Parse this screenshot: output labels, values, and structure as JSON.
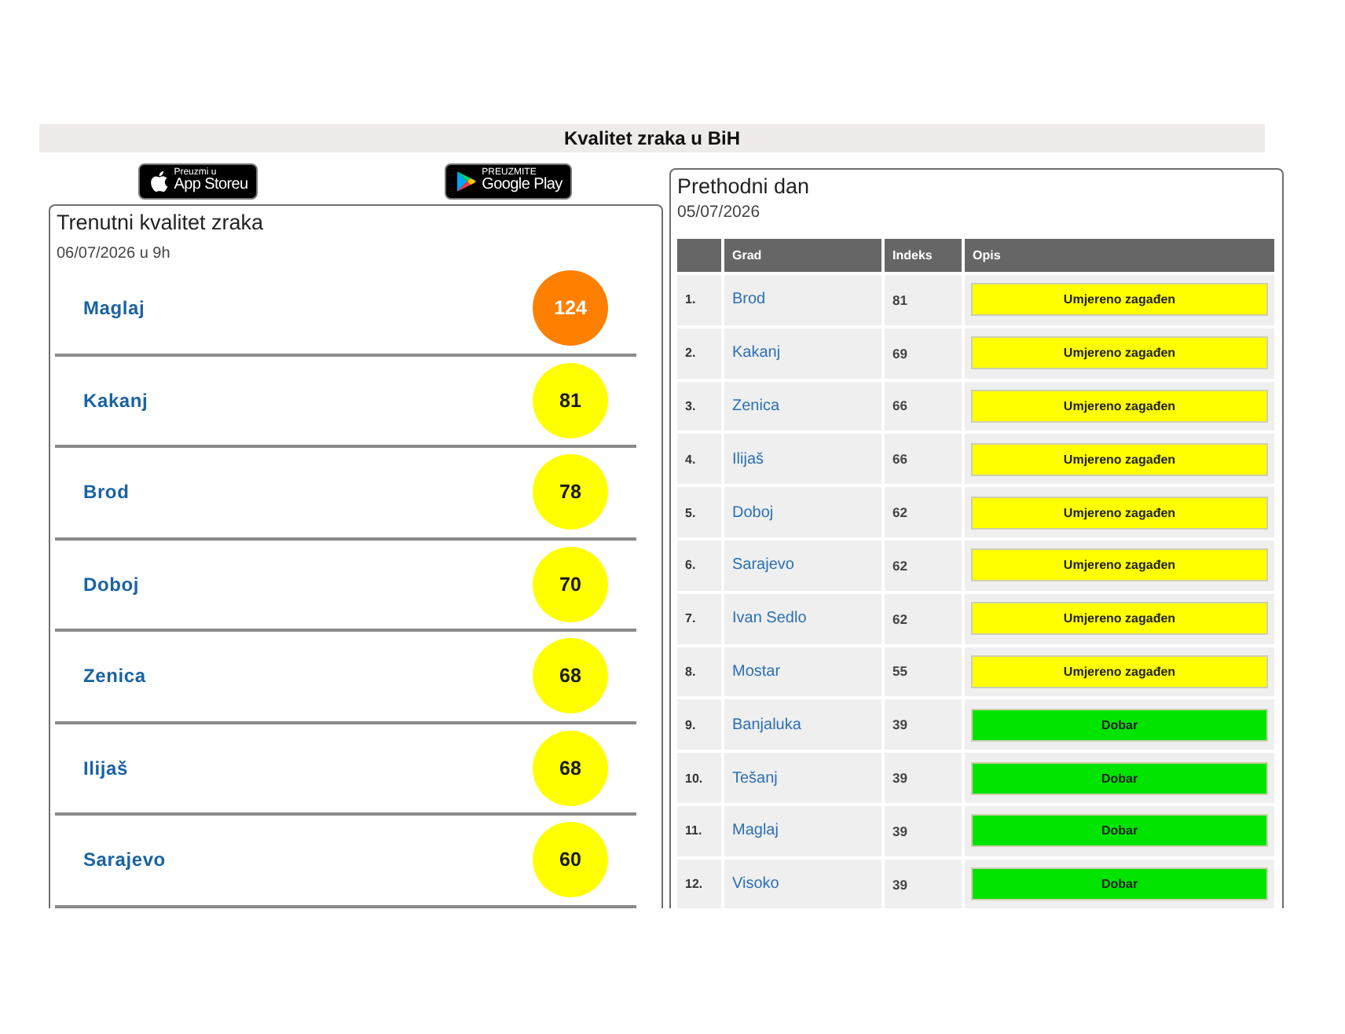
{
  "header": {
    "title": "Kvalitet zraka u BiH"
  },
  "store_badges": [
    {
      "kind": "apple",
      "caption": "Preuzmi u",
      "label": "App Storeu"
    },
    {
      "kind": "google",
      "caption": "PREUZMITE",
      "label": "Google Play"
    }
  ],
  "current": {
    "title": "Trenutni kvalitet zraka",
    "date": "06/07/2026 u 9h",
    "cities": [
      {
        "name": "Maglaj",
        "index": "124",
        "color": "#ff7f00"
      },
      {
        "name": "Kakanj",
        "index": "81",
        "color": "#ffff00"
      },
      {
        "name": "Brod",
        "index": "78",
        "color": "#ffff00"
      },
      {
        "name": "Doboj",
        "index": "70",
        "color": "#ffff00"
      },
      {
        "name": "Zenica",
        "index": "68",
        "color": "#ffff00"
      },
      {
        "name": "Ilijaš",
        "index": "68",
        "color": "#ffff00"
      },
      {
        "name": "Sarajevo",
        "index": "60",
        "color": "#ffff00"
      }
    ]
  },
  "previous": {
    "title": "Prethodni dan",
    "date": "05/07/2026",
    "columns": [
      "Grad",
      "Indeks",
      "Opis"
    ],
    "rows": [
      {
        "rank": "1.",
        "city": "Brod",
        "index": "81",
        "description": "Umjereno zagađen",
        "color": "#ffff00"
      },
      {
        "rank": "2.",
        "city": "Kakanj",
        "index": "69",
        "description": "Umjereno zagađen",
        "color": "#ffff00"
      },
      {
        "rank": "3.",
        "city": "Zenica",
        "index": "66",
        "description": "Umjereno zagađen",
        "color": "#ffff00"
      },
      {
        "rank": "4.",
        "city": "Ilijaš",
        "index": "66",
        "description": "Umjereno zagađen",
        "color": "#ffff00"
      },
      {
        "rank": "5.",
        "city": "Doboj",
        "index": "62",
        "description": "Umjereno zagađen",
        "color": "#ffff00"
      },
      {
        "rank": "6.",
        "city": "Sarajevo",
        "index": "62",
        "description": "Umjereno zagađen",
        "color": "#ffff00"
      },
      {
        "rank": "7.",
        "city": "Ivan Sedlo",
        "index": "62",
        "description": "Umjereno zagađen",
        "color": "#ffff00"
      },
      {
        "rank": "8.",
        "city": "Mostar",
        "index": "55",
        "description": "Umjereno zagađen",
        "color": "#ffff00"
      },
      {
        "rank": "9.",
        "city": "Banjaluka",
        "index": "39",
        "description": "Dobar",
        "color": "#00e400"
      },
      {
        "rank": "10.",
        "city": "Tešanj",
        "index": "39",
        "description": "Dobar",
        "color": "#00e400"
      },
      {
        "rank": "11.",
        "city": "Maglaj",
        "index": "39",
        "description": "Dobar",
        "color": "#00e400"
      },
      {
        "rank": "12.",
        "city": "Visoko",
        "index": "39",
        "description": "Dobar",
        "color": "#00e400"
      }
    ]
  }
}
